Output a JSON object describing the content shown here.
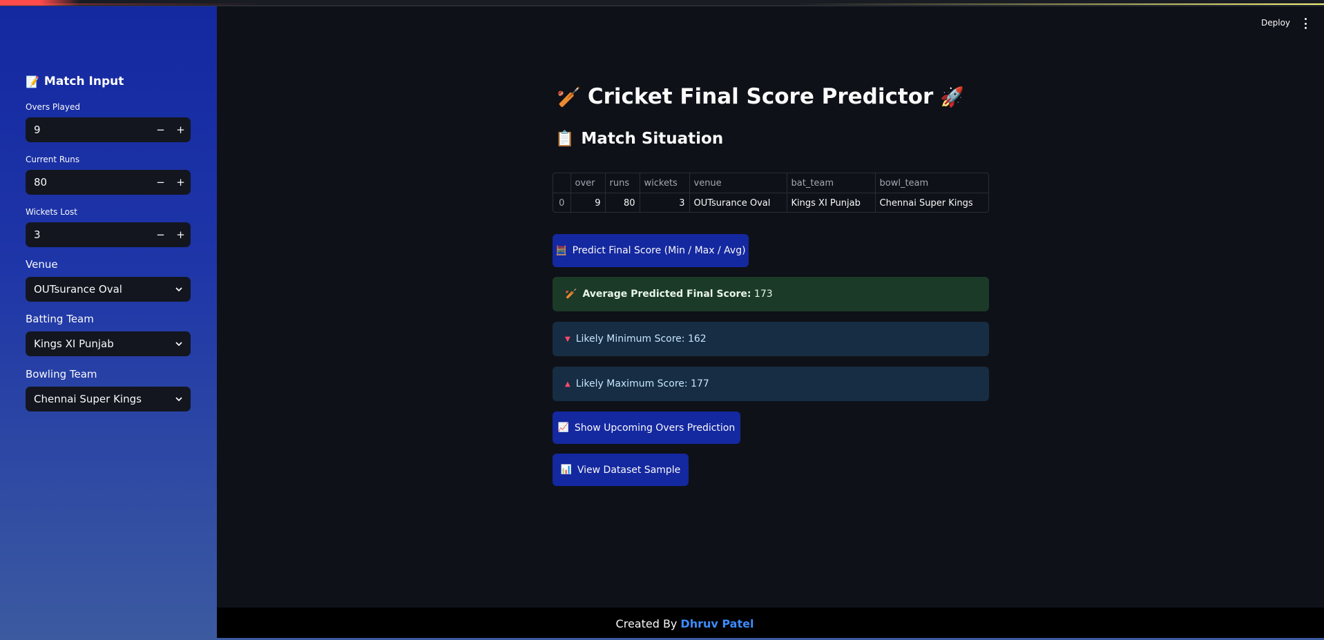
{
  "header": {
    "deploy_label": "Deploy"
  },
  "sidebar": {
    "title_emoji": "📝",
    "title": "Match Input",
    "overs": {
      "label": "Overs Played",
      "value": "9"
    },
    "runs": {
      "label": "Current Runs",
      "value": "80"
    },
    "wickets": {
      "label": "Wickets Lost",
      "value": "3"
    },
    "venue": {
      "label": "Venue",
      "value": "OUTsurance Oval"
    },
    "batting": {
      "label": "Batting Team",
      "value": "Kings XI Punjab"
    },
    "bowling": {
      "label": "Bowling Team",
      "value": "Chennai Super Kings"
    },
    "minus": "−",
    "plus": "+"
  },
  "main": {
    "title_emoji_left": "🏏",
    "title": "Cricket Final Score Predictor",
    "title_emoji_right": "🚀",
    "situation_emoji": "📋",
    "situation_title": "Match Situation",
    "table": {
      "columns": [
        "",
        "over",
        "runs",
        "wickets",
        "venue",
        "bat_team",
        "bowl_team"
      ],
      "row": {
        "index": "0",
        "over": "9",
        "runs": "80",
        "wickets": "3",
        "venue": "OUTsurance Oval",
        "bat_team": "Kings XI Punjab",
        "bowl_team": "Chennai Super Kings"
      }
    },
    "predict_button": {
      "emoji": "🧮",
      "label": "Predict Final Score (Min / Max / Avg)"
    },
    "avg_result": {
      "emoji": "🏏",
      "label": "Average Predicted Final Score:",
      "value": "173"
    },
    "min_result": {
      "icon": "▼",
      "label": "Likely Minimum Score: 162"
    },
    "max_result": {
      "icon": "▲",
      "label": "Likely Maximum Score: 177"
    },
    "overs_button": {
      "emoji": "📈",
      "label": "Show Upcoming Overs Prediction"
    },
    "dataset_button": {
      "emoji": "📊",
      "label": "View Dataset Sample"
    }
  },
  "footer": {
    "prefix": "Created By",
    "author": "Dhruv Patel"
  }
}
